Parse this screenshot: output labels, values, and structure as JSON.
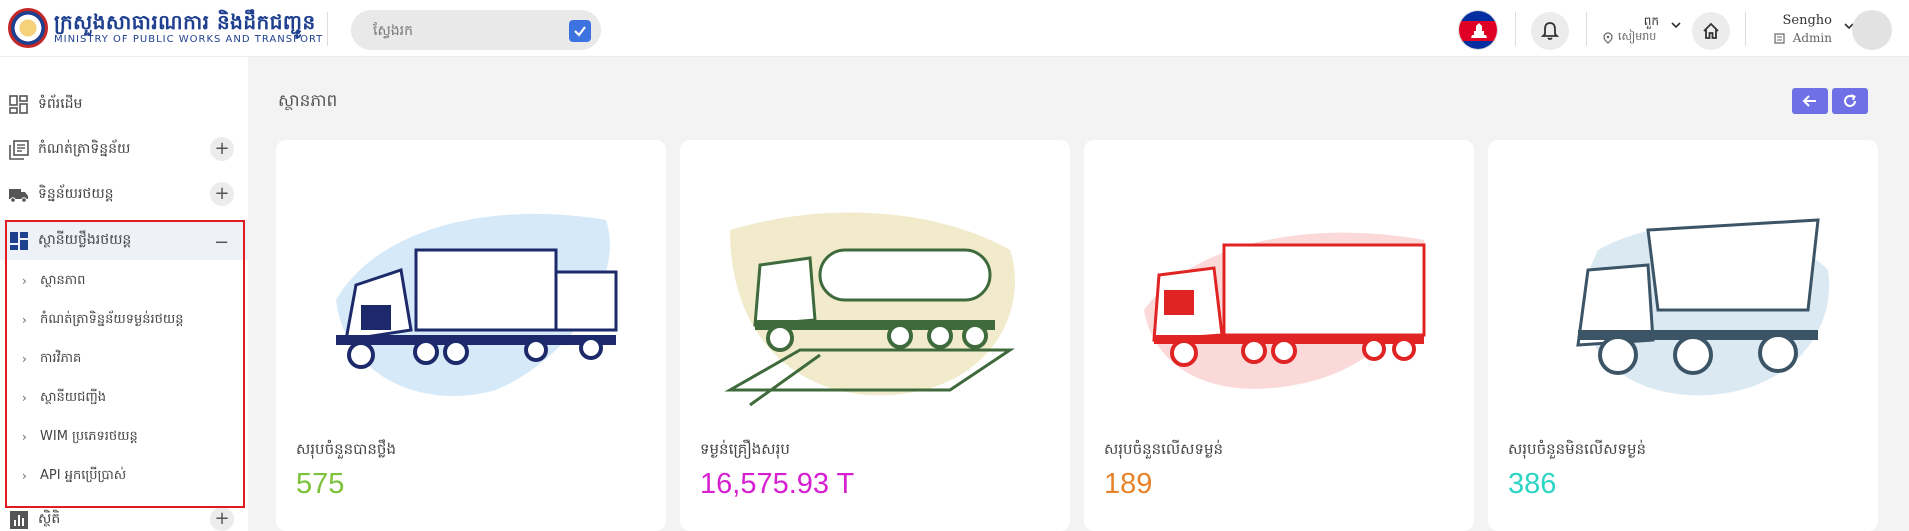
{
  "header": {
    "logo_kh": "ក្រសួងសាធារណការ និងដឹកជញ្ជូន",
    "logo_en": "MINISTRY OF PUBLIC WORKS AND TRANSPORT",
    "search_placeholder": "ស្វែងរក",
    "location_top": "ពួក",
    "location_bottom": "សៀមរាប",
    "user_name": "Sengho",
    "user_role": "Admin"
  },
  "sidebar": {
    "items": [
      {
        "label": "ទំព័រដើម",
        "icon": "dashboard-icon"
      },
      {
        "label": "កំណត់ត្រាទិន្នន័យ",
        "icon": "records-icon"
      },
      {
        "label": "ទិន្នន័យរថយន្ត",
        "icon": "truck-icon"
      },
      {
        "label": "ស្ថានីយថ្លឹងរថយន្ត",
        "icon": "grid-icon"
      },
      {
        "label": "ស្ថិតិ",
        "icon": "bar-chart-icon"
      }
    ],
    "sub_items": [
      {
        "label": "ស្ថានភាព"
      },
      {
        "label": "កំណត់ត្រាទិន្នន័យទម្ងន់រថយន្ត"
      },
      {
        "label": "ការវិភាគ"
      },
      {
        "label": "ស្ថានីយជញ្ជីង"
      },
      {
        "label": "WIM ប្រភេទរថយន្ត"
      },
      {
        "label": "API អ្នកប្រើប្រាស់"
      }
    ]
  },
  "main": {
    "title": "ស្ថានភាព",
    "cards": [
      {
        "label": "សរុបចំនួនបានថ្លឹង",
        "value": "575",
        "color": "#7cc23a"
      },
      {
        "label": "ទម្ងន់គ្រឿងសរុប",
        "value": "16,575.93 T",
        "color": "#d61fd0"
      },
      {
        "label": "សរុបចំនួនលើសទម្ងន់",
        "value": "189",
        "color": "#e8832a"
      },
      {
        "label": "សរុបចំនួនមិនលើសទម្ងន់",
        "value": "386",
        "color": "#2dd5c4"
      }
    ]
  },
  "colors": {
    "accent": "#6f70e6",
    "highlight_box": "#e11b22",
    "search_check": "#3d73e0"
  }
}
